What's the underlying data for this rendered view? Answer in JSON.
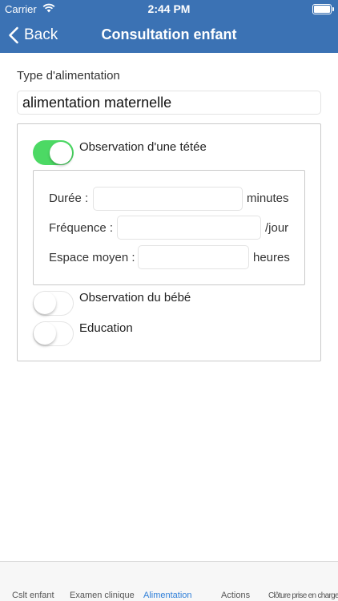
{
  "status_bar": {
    "carrier": "Carrier",
    "time": "2:44 PM"
  },
  "nav": {
    "back_label": "Back",
    "title": "Consultation enfant"
  },
  "feeding": {
    "label": "Type d'alimentation",
    "selected_value": "alimentation maternelle"
  },
  "sections": {
    "feeding_observation": {
      "label": "Observation d'une tétée",
      "enabled": true
    },
    "baby_observation": {
      "label": "Observation du bébé",
      "enabled": false
    },
    "education": {
      "label": "Education",
      "enabled": false
    }
  },
  "feeding_fields": {
    "duration": {
      "label": "Durée :",
      "value": "",
      "unit": "minutes"
    },
    "frequency": {
      "label": "Fréquence :",
      "value": "",
      "unit": "/jour"
    },
    "average_interval": {
      "label": "Espace moyen :",
      "value": "",
      "unit": "heures"
    }
  },
  "tabs": [
    {
      "label": "Cslt enfant",
      "active": false
    },
    {
      "label": "Examen clinique",
      "active": false
    },
    {
      "label": "Alimentation",
      "active": true
    },
    {
      "label": "Actions",
      "active": false
    },
    {
      "label": "Clôture prise en charge",
      "active": false
    }
  ],
  "colors": {
    "nav_background": "#3b72b4",
    "toggle_on": "#4cd964",
    "tab_active": "#2f7fd8"
  },
  "icons": {
    "back": "chevron-left-icon",
    "wifi": "wifi-icon",
    "battery": "battery-icon"
  }
}
